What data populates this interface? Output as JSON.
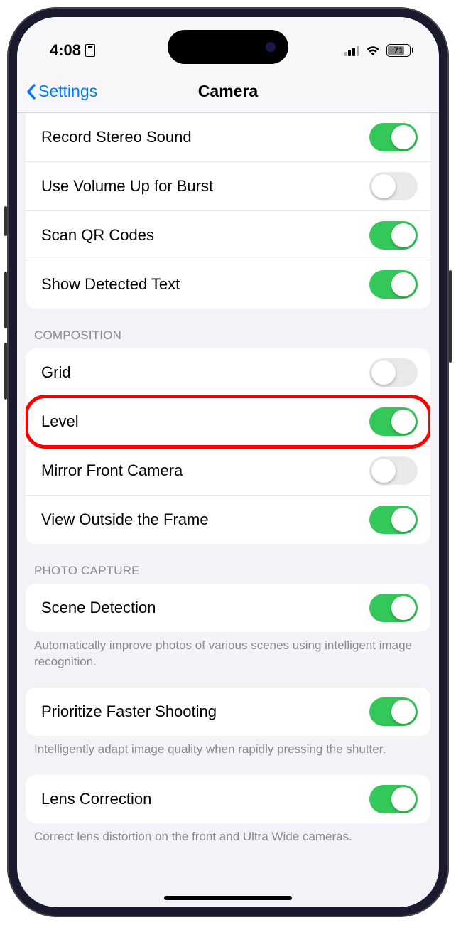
{
  "status": {
    "time": "4:08",
    "battery": "71"
  },
  "nav": {
    "back": "Settings",
    "title": "Camera"
  },
  "top_group": {
    "rows": [
      {
        "label": "Record Stereo Sound",
        "on": true
      },
      {
        "label": "Use Volume Up for Burst",
        "on": false
      },
      {
        "label": "Scan QR Codes",
        "on": true
      },
      {
        "label": "Show Detected Text",
        "on": true
      }
    ]
  },
  "composition": {
    "header": "Composition",
    "rows": [
      {
        "label": "Grid",
        "on": false,
        "highlight": false
      },
      {
        "label": "Level",
        "on": true,
        "highlight": true
      },
      {
        "label": "Mirror Front Camera",
        "on": false,
        "highlight": false
      },
      {
        "label": "View Outside the Frame",
        "on": true,
        "highlight": false
      }
    ]
  },
  "photo_capture": {
    "header": "Photo Capture",
    "scene": {
      "label": "Scene Detection",
      "on": true,
      "footer": "Automatically improve photos of various scenes using intelligent image recognition."
    },
    "faster": {
      "label": "Prioritize Faster Shooting",
      "on": true,
      "footer": "Intelligently adapt image quality when rapidly pressing the shutter."
    },
    "lens": {
      "label": "Lens Correction",
      "on": true,
      "footer": "Correct lens distortion on the front and Ultra Wide cameras."
    }
  }
}
